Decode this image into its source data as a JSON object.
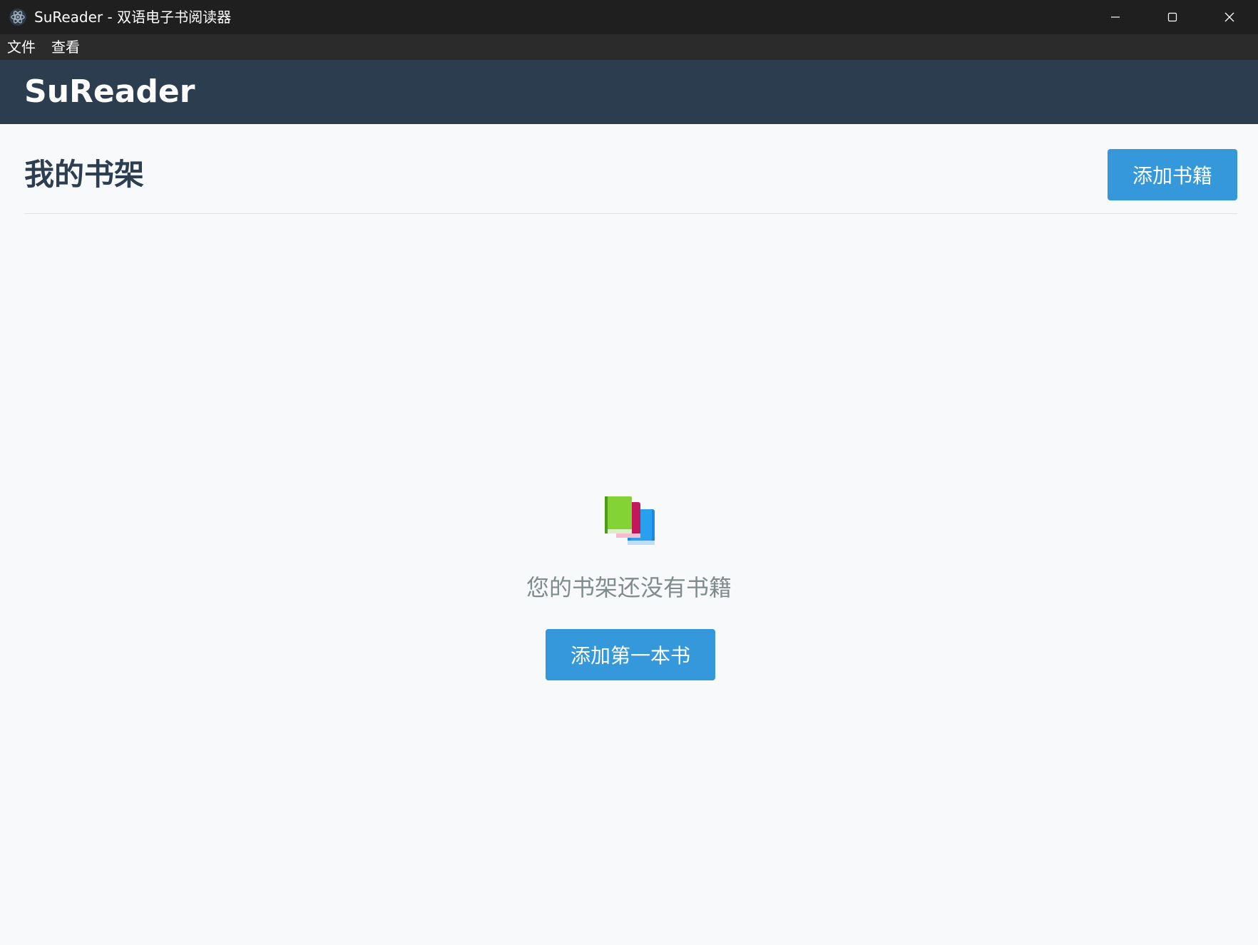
{
  "window": {
    "title": "SuReader - 双语电子书阅读器"
  },
  "menu": {
    "items": [
      {
        "label": "文件"
      },
      {
        "label": "查看"
      }
    ]
  },
  "header": {
    "brand": "SuReader"
  },
  "bookshelf": {
    "title": "我的书架",
    "add_button_label": "添加书籍",
    "empty_message": "您的书架还没有书籍",
    "add_first_button_label": "添加第一本书",
    "empty_icon": "books-icon"
  },
  "colors": {
    "accent": "#3498db",
    "header_bg": "#2d3d50",
    "titlebar_bg": "#1f1f1f",
    "menubar_bg": "#2b2b2b",
    "page_bg": "#f7f9fa",
    "title_text": "#2c3e50",
    "muted_text": "#7f8c8d"
  }
}
